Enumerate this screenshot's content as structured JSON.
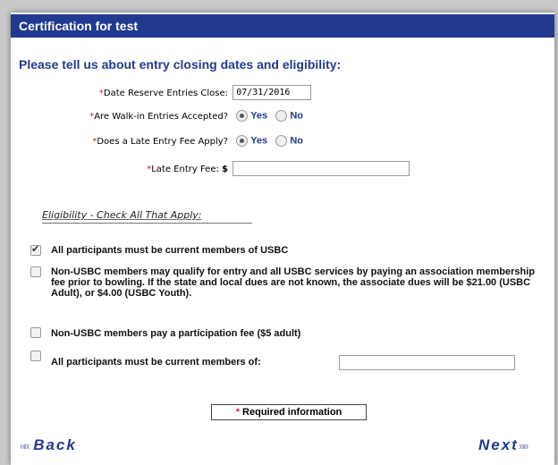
{
  "header": {
    "title": "Certification for test"
  },
  "intro": "Please tell us about entry closing dates and eligibility:",
  "form": {
    "req_mark": "*",
    "reserve_close": {
      "label": "Date Reserve Entries Close:",
      "value": "07/31/2016"
    },
    "walk_in": {
      "label": "Are Walk-in Entries Accepted?",
      "yes": "Yes",
      "no": "No",
      "selected": "Yes"
    },
    "late_fee_apply": {
      "label": "Does a Late Entry Fee Apply?",
      "yes": "Yes",
      "no": "No",
      "selected": "Yes"
    },
    "late_fee": {
      "label": "Late Entry Fee:",
      "currency": "$",
      "value": ""
    }
  },
  "eligibility": {
    "heading": "Eligibility - Check All That Apply:",
    "options": [
      {
        "text": "All participants must be current members of USBC",
        "checked": true
      },
      {
        "text": "Non-USBC members may qualify for entry and all USBC services by paying an association membership fee prior to bowling. If the state and local dues are not known, the associate dues will be $21.00 (USBC Adult), or $4.00 (USBC Youth).",
        "checked": false
      },
      {
        "text": "Non-USBC members pay a participation fee ($5 adult)",
        "checked": false
      },
      {
        "text": "All participants must be current members of:",
        "checked": false,
        "value": ""
      }
    ]
  },
  "legend": {
    "mark": "*",
    "text": "Required information"
  },
  "nav": {
    "back": "Back",
    "next": "Next",
    "back_arrow": "«",
    "next_arrow": "»"
  },
  "colors": {
    "header_bg": "#213a8f",
    "accent": "#213a8f",
    "required": "#e02020"
  }
}
